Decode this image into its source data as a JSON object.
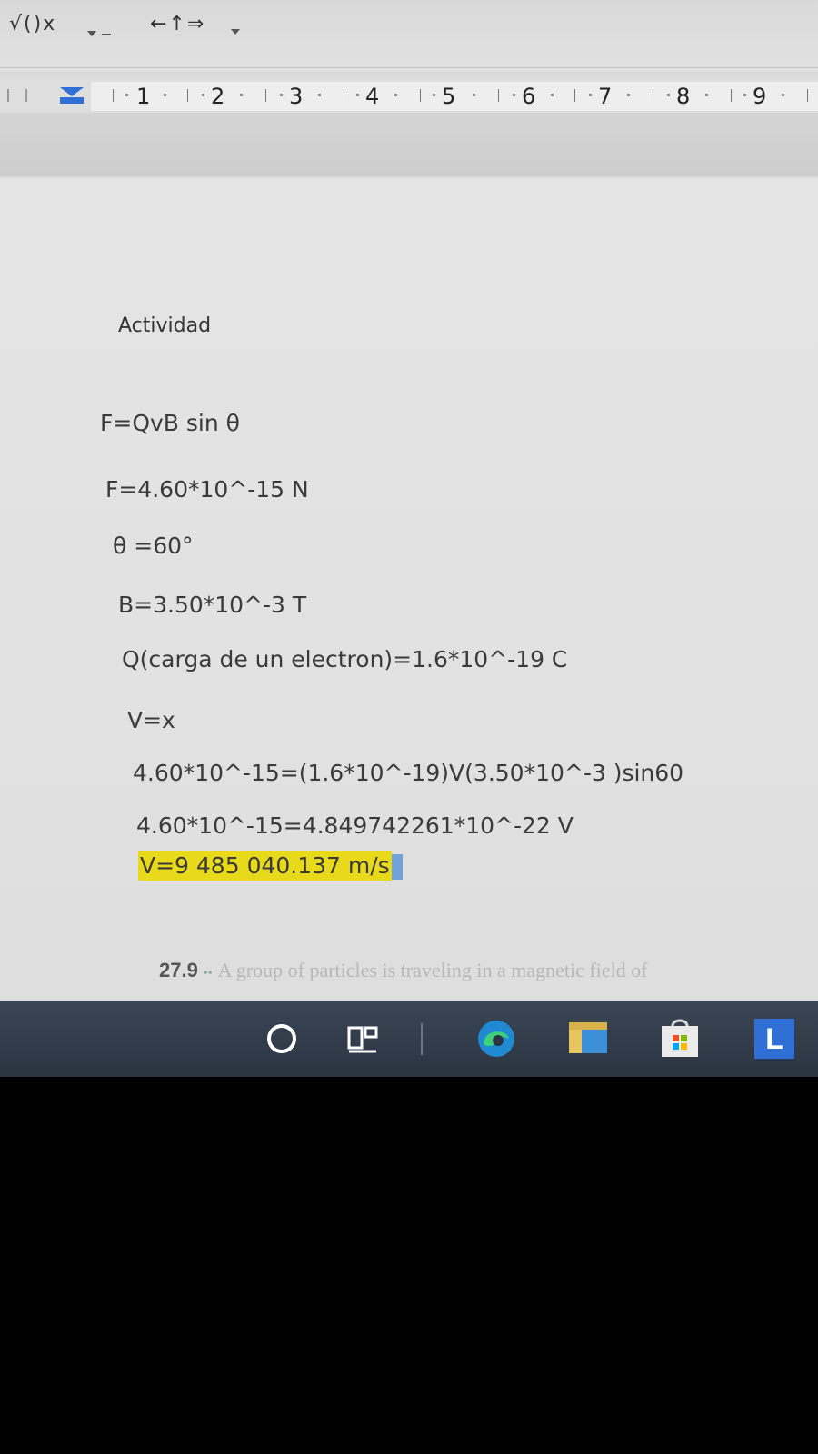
{
  "ribbon": {
    "equation_tools": "√()x",
    "arrows": "←↑⇒"
  },
  "ruler": {
    "numbers": [
      "1",
      "2",
      "3",
      "4",
      "5",
      "6",
      "7",
      "8",
      "9"
    ]
  },
  "document": {
    "heading": "Actividad",
    "lines": [
      "F=QvB sin θ",
      "F=4.60*10^-15 N",
      "θ =60°",
      "B=3.50*10^-3 T",
      "Q(carga de un electron)=1.6*10^-19 C",
      "V=x",
      "4.60*10^-15=(1.6*10^-19)V(3.50*10^-3 )sin60",
      "4.60*10^-15=4.849742261*10^-22 V"
    ],
    "result": "V=9 485 040.137 m/s",
    "next_problem": {
      "number": "27.9",
      "text": "A group of particles is traveling in a magnetic field of"
    }
  },
  "taskbar": {
    "icons": [
      "search-icon",
      "task-view-icon",
      "edge-icon",
      "file-explorer-icon",
      "store-icon",
      "l-app-icon"
    ],
    "l_label": "L"
  },
  "colors": {
    "highlight": "#e8d91a",
    "taskbar": "#2b3441",
    "squiggle": "#c0392b"
  }
}
